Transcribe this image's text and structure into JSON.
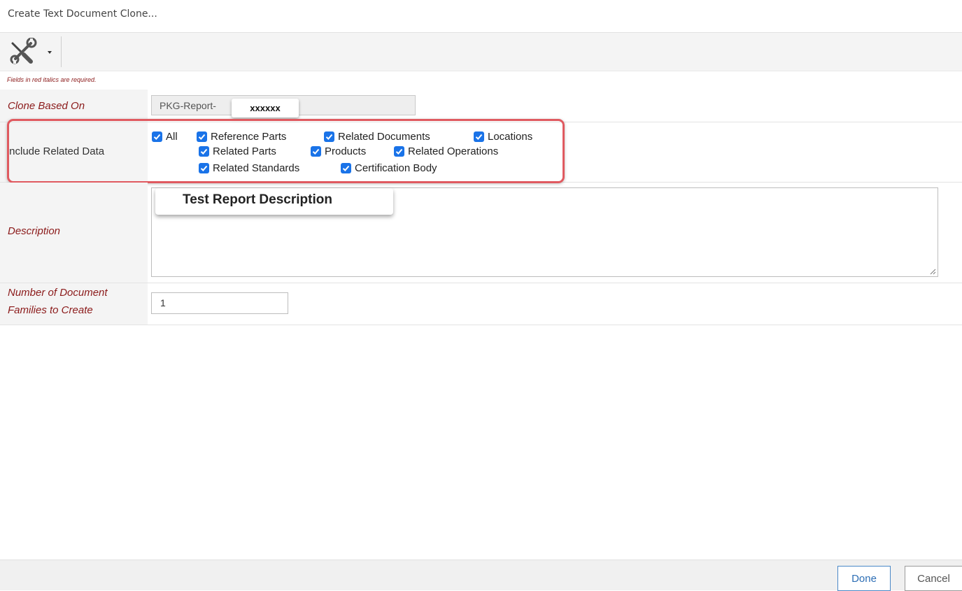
{
  "window": {
    "title": "Create Text Document Clone..."
  },
  "toolbar": {
    "tools_icon": "wrench-screwdriver-icon"
  },
  "form": {
    "required_note": "Fields in red italics are required.",
    "clone_based_on": {
      "label": "Clone Based On",
      "value": "PKG-Report-",
      "redaction_label": "xxxxxx"
    },
    "include_related_data": {
      "label": "Include Related Data",
      "options": [
        {
          "label": "All",
          "checked": true
        },
        {
          "label": "Reference Parts",
          "checked": true
        },
        {
          "label": "Related Documents",
          "checked": true
        },
        {
          "label": "Locations",
          "checked": true
        },
        {
          "label": "Related Parts",
          "checked": true
        },
        {
          "label": "Products",
          "checked": true
        },
        {
          "label": "Related Operations",
          "checked": true
        },
        {
          "label": "Related Standards",
          "checked": true
        },
        {
          "label": "Certification Body",
          "checked": true
        }
      ]
    },
    "description": {
      "label": "Description",
      "overlay_label": "Test Report Description",
      "value": ""
    },
    "number_of_families": {
      "label_line1": "Number of Document",
      "label_line2": "Families to Create",
      "value": "1"
    }
  },
  "footer": {
    "done_label": "Done",
    "cancel_label": "Cancel"
  },
  "colors": {
    "required_label": "#8b1a1a",
    "checkbox": "#1a73e8",
    "highlight_border": "#e05a60",
    "done_button": "#2d6eb5"
  }
}
